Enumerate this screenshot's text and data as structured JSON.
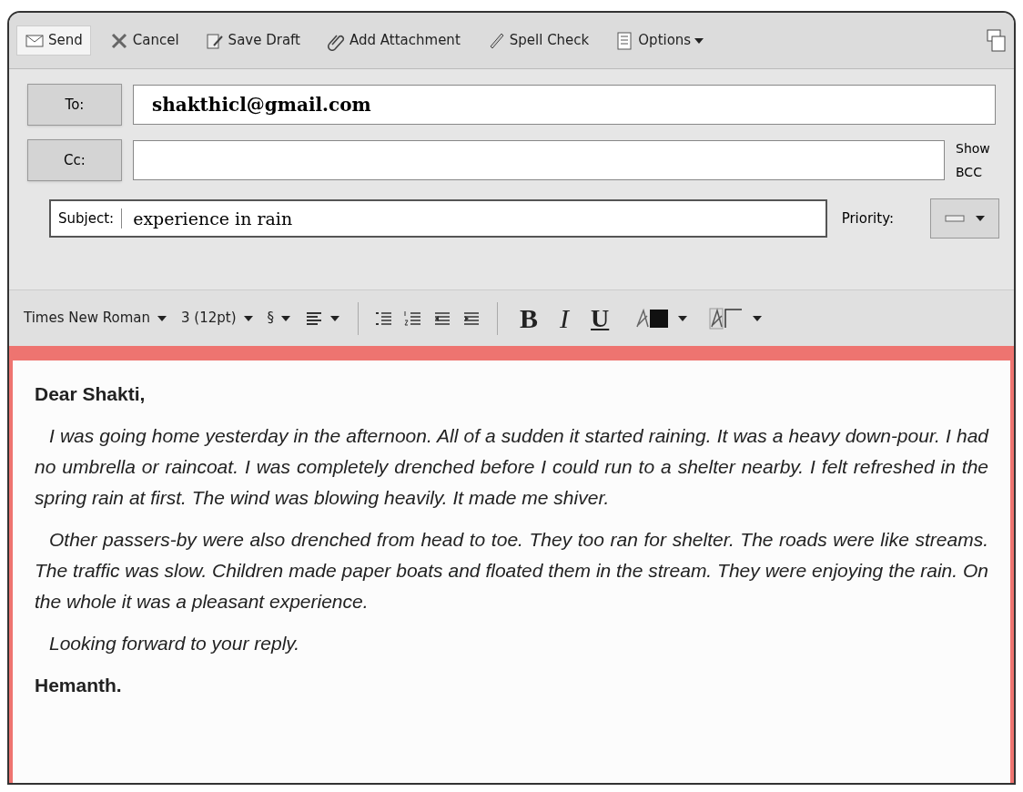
{
  "toolbar": [
    {
      "kind": "send",
      "label": "Send"
    },
    {
      "kind": "cancel",
      "label": "Cancel"
    },
    {
      "kind": "draft",
      "label": "Save Draft"
    },
    {
      "kind": "attach",
      "label": "Add Attachment"
    },
    {
      "kind": "spell",
      "label": "Spell Check"
    },
    {
      "kind": "options",
      "label": "Options"
    }
  ],
  "to": {
    "label": "To:",
    "value": "shakthicl@gmail.com"
  },
  "cc": {
    "label": "Cc:"
  },
  "show_bcc": "Show BCC",
  "subject": {
    "label": "Subject:",
    "value": "experience in rain"
  },
  "priority": {
    "label": "Priority:"
  },
  "format_bar": [
    {
      "kind": "dropdown",
      "label": "Times New Roman"
    },
    {
      "kind": "dropdown",
      "label": "3 (12pt)"
    },
    {
      "kind": "dropdown",
      "label": "§"
    },
    {
      "kind": "align"
    },
    {
      "kind": "sep"
    },
    {
      "kind": "bullets"
    },
    {
      "kind": "numbers"
    },
    {
      "kind": "outdent"
    },
    {
      "kind": "indent"
    },
    {
      "kind": "sep"
    },
    {
      "kind": "bold",
      "label": "B"
    },
    {
      "kind": "italic",
      "label": "I"
    },
    {
      "kind": "underline",
      "label": "U"
    },
    {
      "kind": "textcolor"
    },
    {
      "kind": "highlight"
    }
  ],
  "body": [
    {
      "kind": "greeting",
      "text": "Dear Shakti,"
    },
    {
      "kind": "paragraph",
      "text": "I was going home yesterday in the afternoon.  All of a sudden it started raining.  It was a heavy down-pour.  I had no umbrella or raincoat.  I was completely drenched before I could run to a shelter nearby.  I felt refreshed in the spring rain at first. The wind was blowing heavily.  It made me shiver."
    },
    {
      "kind": "paragraph",
      "text": "Other passers-by were also drenched from head to toe.  They too ran for shelter.  The roads were like streams.  The traffic was slow.  Children made paper boats and floated them in the stream.  They were enjoying the rain.  On the whole it was a pleasant experience."
    },
    {
      "kind": "closing",
      "text": "Looking forward to your reply."
    },
    {
      "kind": "signature",
      "text": "Hemanth."
    }
  ]
}
